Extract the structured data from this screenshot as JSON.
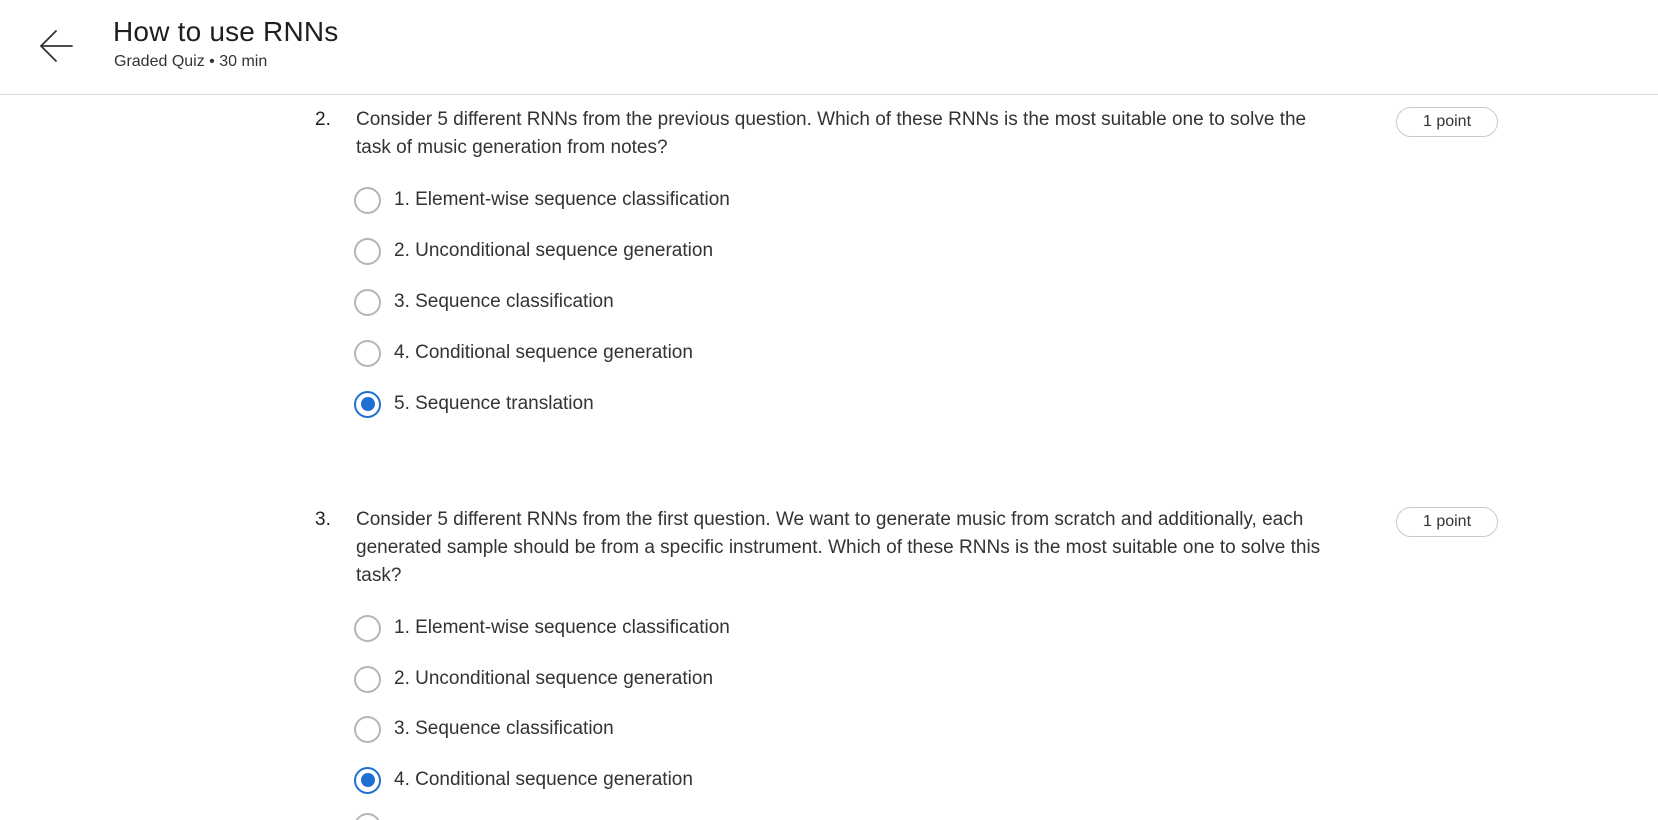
{
  "header": {
    "title": "How to use RNNs",
    "subtitle": "Graded Quiz • 30 min",
    "back_icon": "arrow-left-icon"
  },
  "questions": [
    {
      "number": "2.",
      "text": "Consider 5 different RNNs from the previous question. Which of these RNNs is the most suitable one to solve the task of music generation from notes?",
      "points": "1 point",
      "options": [
        {
          "label": "1. Element-wise sequence classification",
          "selected": false
        },
        {
          "label": "2. Unconditional sequence generation",
          "selected": false
        },
        {
          "label": "3. Sequence classification",
          "selected": false
        },
        {
          "label": "4. Conditional sequence generation",
          "selected": false
        },
        {
          "label": "5. Sequence translation",
          "selected": true
        }
      ]
    },
    {
      "number": "3.",
      "text": "Consider 5 different RNNs from the first question. We want to generate music from scratch and additionally, each generated sample should be from a specific instrument. Which of these RNNs is the most suitable one to solve this task?",
      "points": "1 point",
      "options": [
        {
          "label": "1. Element-wise sequence classification",
          "selected": false
        },
        {
          "label": "2. Unconditional sequence generation",
          "selected": false
        },
        {
          "label": "3. Sequence classification",
          "selected": false
        },
        {
          "label": "4. Conditional sequence generation",
          "selected": true
        }
      ]
    }
  ],
  "colors": {
    "accent": "#1f6fd1",
    "radio_border": "#b5b5b5",
    "divider": "#d9d9d9"
  }
}
